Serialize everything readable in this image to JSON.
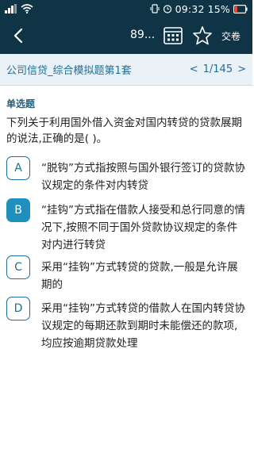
{
  "status_bar": {
    "time": "09:32",
    "battery_pct": "15%"
  },
  "app_bar": {
    "progress": "89...",
    "submit_label": "交卷",
    "icons": [
      "back-icon",
      "answer-sheet-icon",
      "star-icon"
    ]
  },
  "title_bar": {
    "paper_title": "公司信贷_综合模拟题第1套",
    "prev": "<",
    "page": "1/145",
    "next": ">"
  },
  "question": {
    "type": "单选题",
    "text": "下列关于利用国外借入资金对国内转贷的贷款展期的说法,正确的是( )。",
    "selected": "B",
    "options": [
      {
        "letter": "A",
        "text": "“脱钩”方式指按照与国外银行签订的贷款协议规定的条件对内转贷"
      },
      {
        "letter": "B",
        "text": "“挂钩”方式指在借款人接受和总行同意的情况下,按照不同于国外贷款协议规定的条件对内进行转贷"
      },
      {
        "letter": "C",
        "text": "采用“挂钩”方式转贷的贷款,一般是允许展期的"
      },
      {
        "letter": "D",
        "text": "采用“挂钩”方式转贷的借款人在国内转贷协议规定的每期还款到期时未能偿还的款项,均应按逾期贷款处理"
      }
    ]
  },
  "colors": {
    "header_bg": "#0f3446",
    "accent": "#1f6e96",
    "selected": "#1f8fc0",
    "title_bar_bg": "#eaf2f7"
  }
}
